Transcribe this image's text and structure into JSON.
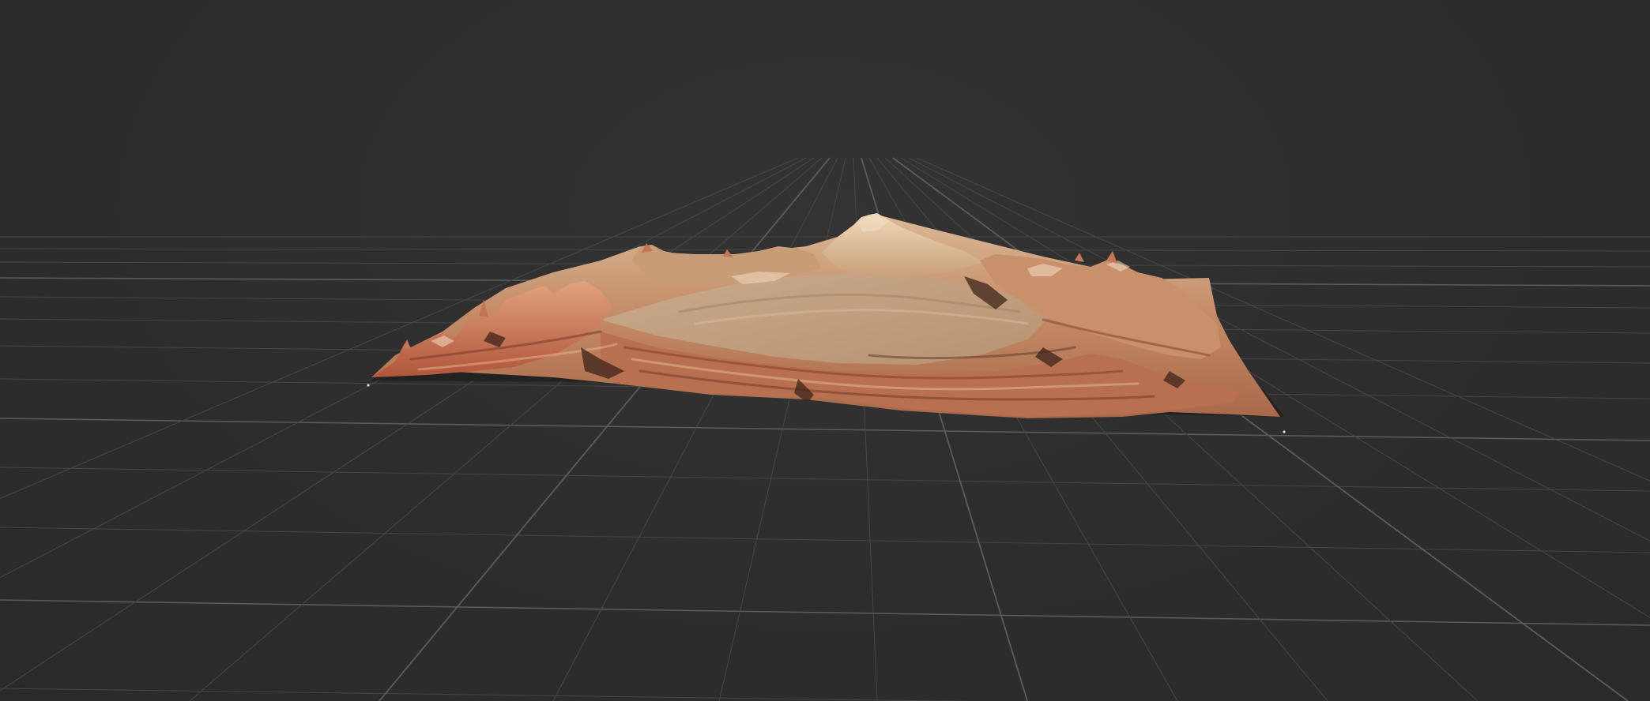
{
  "viewer": {
    "background_color": "#2e2e2e",
    "grid_color": "#4a4a4a",
    "grid_major_color": "#5c5c5c",
    "terrain_colors": {
      "highlight": "#e8c9a3",
      "mid": "#c98a63",
      "shadow": "#5b3527",
      "rust": "#c45f3d",
      "sand": "#d7b48f"
    }
  }
}
